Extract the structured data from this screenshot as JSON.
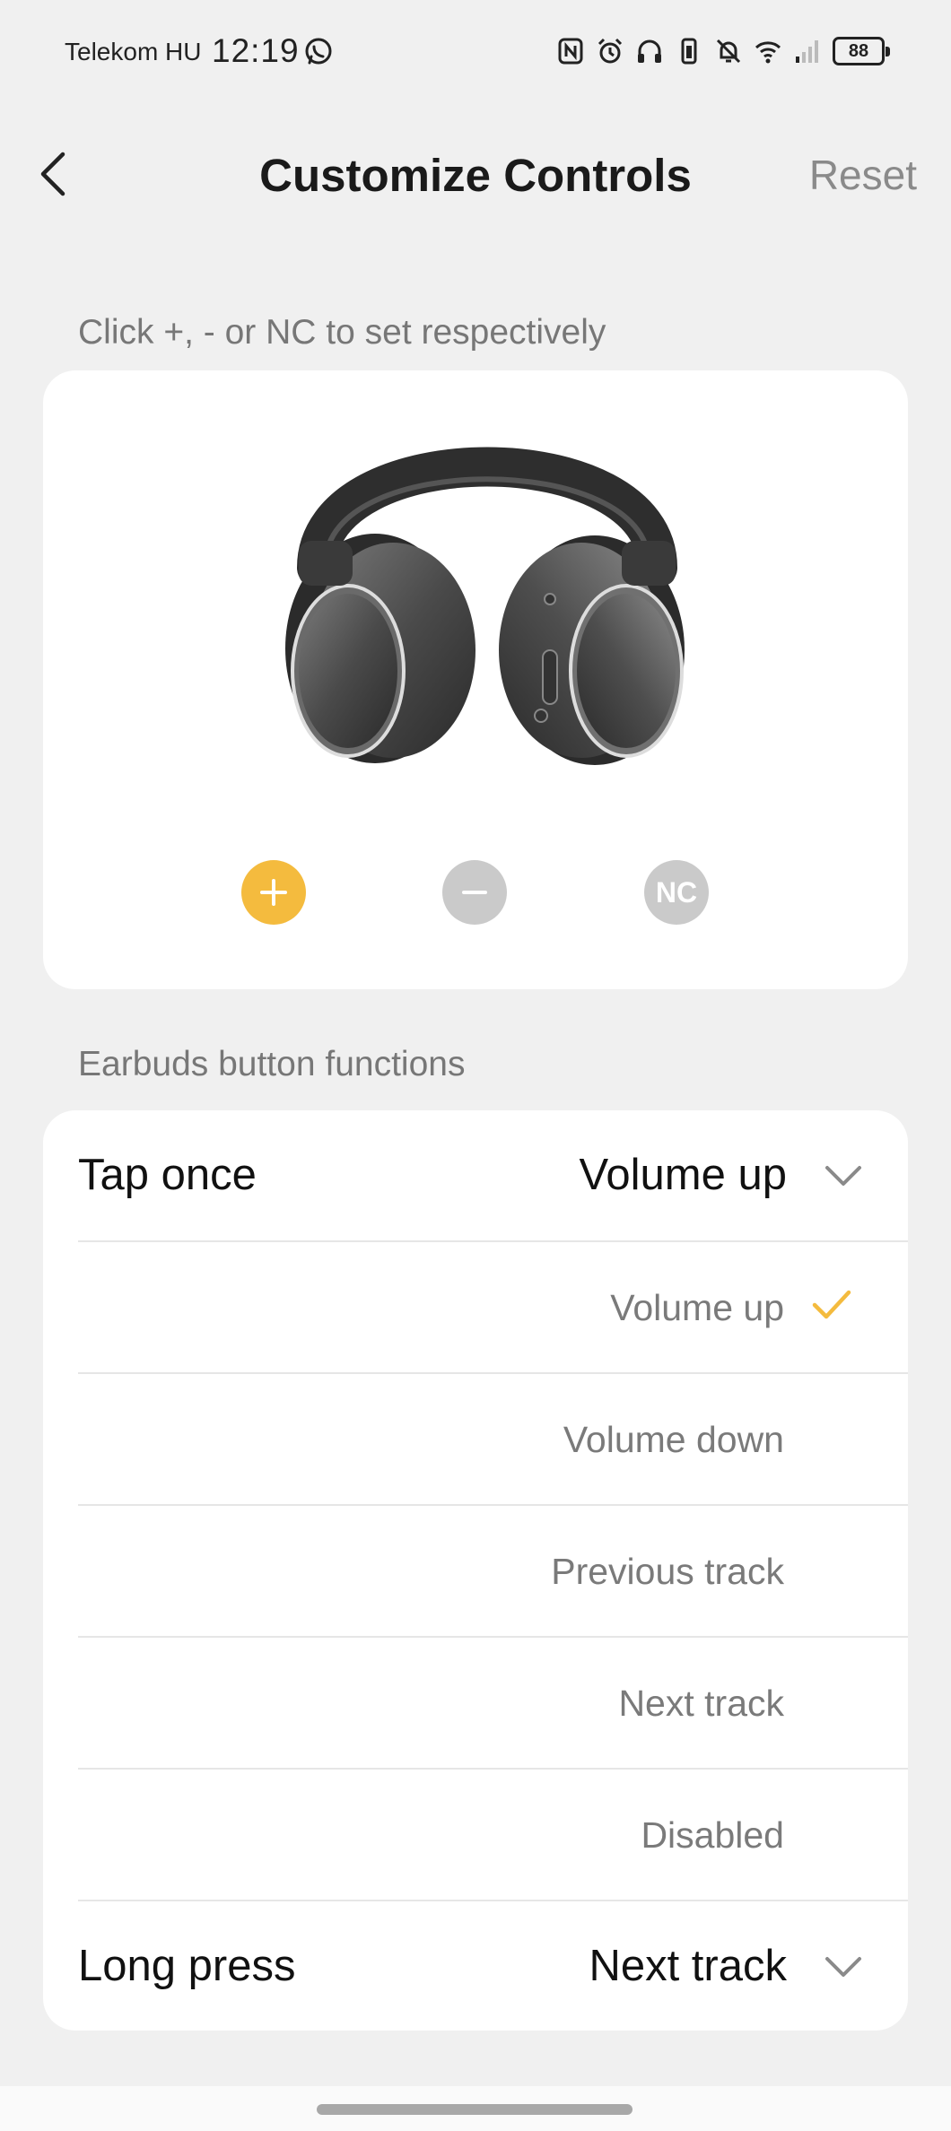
{
  "status_bar": {
    "carrier": "Telekom HU",
    "time": "12:19",
    "battery": "88",
    "icons": [
      "whatsapp-icon",
      "nfc-icon",
      "alarm-icon",
      "headphones-icon",
      "vibrate-icon",
      "bell-off-icon",
      "wifi-icon",
      "signal-icon",
      "battery-icon"
    ]
  },
  "header": {
    "title": "Customize Controls",
    "reset_label": "Reset",
    "back_icon": "chevron-left-icon"
  },
  "device_section": {
    "hint": "Click +, - or NC to set respectively",
    "buttons": [
      {
        "label": "+",
        "name": "plus",
        "selected": true,
        "color": "#f4bb3e"
      },
      {
        "label": "−",
        "name": "minus",
        "selected": false,
        "color": "#cacaca"
      },
      {
        "label": "NC",
        "name": "noise-cancel",
        "selected": false,
        "color": "#cacaca"
      }
    ]
  },
  "functions_section": {
    "title": "Earbuds button functions",
    "tap_once": {
      "label": "Tap once",
      "value": "Volume up"
    },
    "options": [
      {
        "label": "Volume up",
        "selected": true
      },
      {
        "label": "Volume down",
        "selected": false
      },
      {
        "label": "Previous track",
        "selected": false
      },
      {
        "label": "Next track",
        "selected": false
      },
      {
        "label": "Disabled",
        "selected": false
      }
    ],
    "long_press": {
      "label": "Long press",
      "value": "Next track"
    }
  },
  "colors": {
    "accent": "#f4bb3e",
    "inactive": "#cacaca",
    "background": "#f0f0f0",
    "card": "#ffffff"
  }
}
